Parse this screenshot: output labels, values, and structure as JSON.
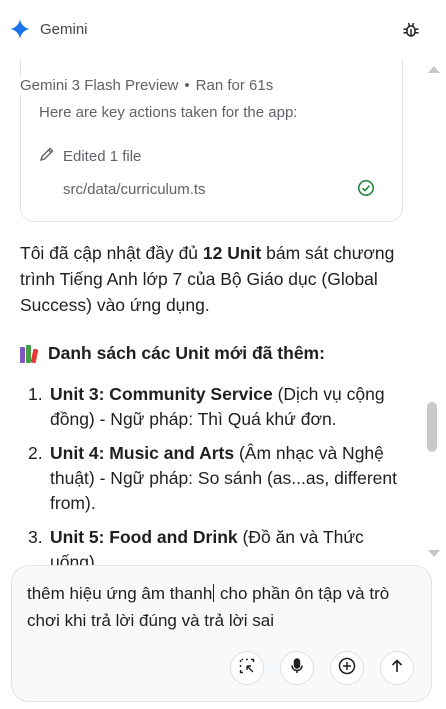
{
  "header": {
    "title": "Gemini",
    "logo_icon": "gemini-sparkle-icon",
    "debug_icon": "bug-icon",
    "accent_color": "#1a73e8"
  },
  "run_meta": {
    "model": "Gemini 3 Flash Preview",
    "separator": "•",
    "duration": "Ran for 61s"
  },
  "actions_card": {
    "intro": "Here are key actions taken for the app:",
    "edit_label": "Edited 1 file",
    "edit_icon": "pencil-icon",
    "file_path": "src/data/curriculum.ts",
    "status_icon": "check-circle-icon",
    "status_color": "#188038"
  },
  "response": {
    "para_before": "Tôi đã cập nhật đầy đủ ",
    "para_bold": "12 Unit",
    "para_after": " bám sát chương trình Tiếng Anh lớp 7 của Bộ Giáo dục (Global Success) vào ứng dụng.",
    "heading_icon": "books-icon",
    "heading": "Danh sách các Unit mới đã thêm:",
    "units": [
      {
        "num": "1.",
        "title": "Unit 3: Community Service",
        "desc": " (Dịch vụ cộng đồng) - Ngữ pháp: Thì Quá khứ đơn."
      },
      {
        "num": "2.",
        "title": "Unit 4: Music and Arts",
        "desc": " (Âm nhạc và Nghệ thuật) - Ngữ pháp: So sánh (as...as, different from)."
      },
      {
        "num": "3.",
        "title": "Unit 5: Food and Drink",
        "desc": " (Đồ ăn và Thức uống)"
      }
    ]
  },
  "composer": {
    "text_before_caret": "thêm hiệu ứng âm thanh",
    "text_after_caret": " cho phần ôn tập và trò chơi khi trả lời đúng và trả lời sai",
    "buttons": {
      "select": "select-area-icon",
      "mic": "microphone-icon",
      "add": "plus-circle-icon",
      "send": "arrow-up-icon"
    }
  }
}
